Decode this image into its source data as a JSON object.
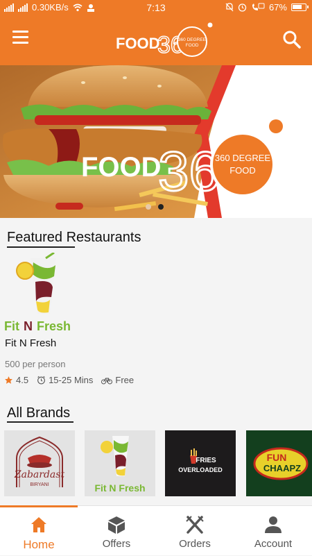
{
  "status_bar": {
    "speed": "0.30KB/s",
    "time": "7:13",
    "battery": "67%"
  },
  "app_bar": {
    "logo_text": "FOOD",
    "logo_digits": "360",
    "logo_tagline_1": "360 DEGREE",
    "logo_tagline_2": "FOOD",
    "icons": {
      "menu": "hamburger-menu-icon",
      "search": "search-icon"
    }
  },
  "banner": {
    "logo_text": "FOOD",
    "logo_digits": "360",
    "tagline_1": "360 DEGREE",
    "tagline_2": "FOOD",
    "slide_count": 2,
    "active_slide": 2
  },
  "featured": {
    "title": "Featured Restaurants",
    "restaurant": {
      "logo_text_1": "Fit",
      "logo_text_2": "N",
      "logo_text_3": "Fresh",
      "name": "Fit N Fresh",
      "price": "500 per person",
      "rating": "4.5",
      "time": "15-25 Mins",
      "delivery": "Free"
    }
  },
  "brands": {
    "title": "All Brands",
    "items": [
      {
        "line1": "Zabardast",
        "line2": "BIRYANI"
      },
      {
        "line1": "Fit N Fresh"
      },
      {
        "line1": "FRIES",
        "line2": "OVERLOADED"
      },
      {
        "line1": "FUN",
        "line2": "CHAAPZ"
      }
    ]
  },
  "bottom_nav": {
    "items": [
      {
        "label": "Home",
        "icon": "home-icon"
      },
      {
        "label": "Offers",
        "icon": "offers-box-icon"
      },
      {
        "label": "Orders",
        "icon": "fork-knife-icon"
      },
      {
        "label": "Account",
        "icon": "person-icon"
      }
    ]
  },
  "colors": {
    "primary": "#ee7a27",
    "fresh_green": "#7ab833",
    "maroon": "#7a1f2b"
  }
}
